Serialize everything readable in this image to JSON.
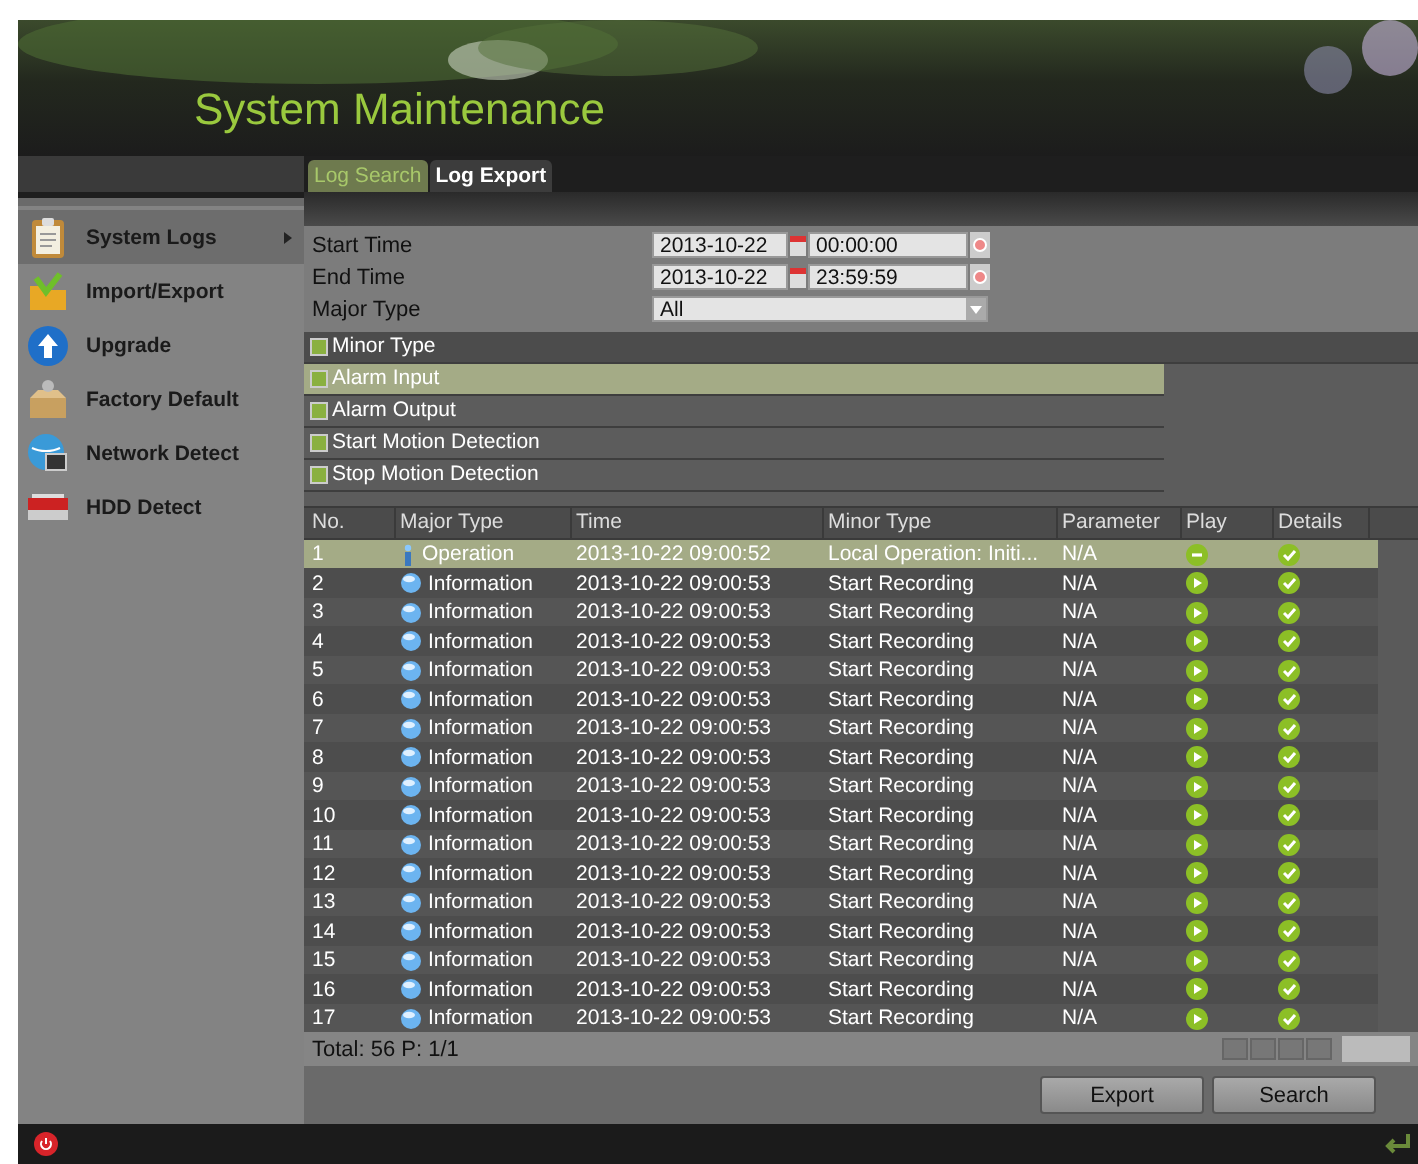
{
  "window": {
    "title": "System Maintenance"
  },
  "sidebar": {
    "items": [
      {
        "label": "System Logs",
        "kind": "logs",
        "selected": true
      },
      {
        "label": "Import/Export",
        "kind": "import",
        "selected": false
      },
      {
        "label": "Upgrade",
        "kind": "upgrade",
        "selected": false
      },
      {
        "label": "Factory Default",
        "kind": "factory",
        "selected": false
      },
      {
        "label": "Network Detect",
        "kind": "network",
        "selected": false
      },
      {
        "label": "HDD Detect",
        "kind": "hdd",
        "selected": false
      }
    ]
  },
  "tabs": [
    {
      "label": "Log Search",
      "selected": true
    },
    {
      "label": "Log Export",
      "selected": false
    }
  ],
  "form": {
    "start_time": {
      "label": "Start Time",
      "date": "2013-10-22",
      "time": "00:00:00"
    },
    "end_time": {
      "label": "End Time",
      "date": "2013-10-22",
      "time": "23:59:59"
    },
    "major_type": {
      "label": "Major Type",
      "value": "All"
    }
  },
  "minor_type_header": {
    "label": "Minor Type",
    "checked": true
  },
  "minor_types": [
    {
      "label": "Alarm Input",
      "checked": true,
      "selected": true
    },
    {
      "label": "Alarm Output",
      "checked": true,
      "selected": false
    },
    {
      "label": "Start Motion Detection",
      "checked": true,
      "selected": false
    },
    {
      "label": "Stop Motion Detection",
      "checked": true,
      "selected": false
    }
  ],
  "table": {
    "columns": [
      "No.",
      "Major Type",
      "Time",
      "Minor Type",
      "Parameter",
      "Play",
      "Details"
    ],
    "rows": [
      {
        "no": "1",
        "major_type": "Operation",
        "kind": "operation",
        "time": "2013-10-22 09:00:52",
        "minor_type": "Local Operation: Initi...",
        "parameter": "N/A",
        "playable": false,
        "selected": true
      },
      {
        "no": "2",
        "major_type": "Information",
        "kind": "information",
        "time": "2013-10-22 09:00:53",
        "minor_type": "Start Recording",
        "parameter": "N/A",
        "playable": true,
        "selected": false
      },
      {
        "no": "3",
        "major_type": "Information",
        "kind": "information",
        "time": "2013-10-22 09:00:53",
        "minor_type": "Start Recording",
        "parameter": "N/A",
        "playable": true,
        "selected": false
      },
      {
        "no": "4",
        "major_type": "Information",
        "kind": "information",
        "time": "2013-10-22 09:00:53",
        "minor_type": "Start Recording",
        "parameter": "N/A",
        "playable": true,
        "selected": false
      },
      {
        "no": "5",
        "major_type": "Information",
        "kind": "information",
        "time": "2013-10-22 09:00:53",
        "minor_type": "Start Recording",
        "parameter": "N/A",
        "playable": true,
        "selected": false
      },
      {
        "no": "6",
        "major_type": "Information",
        "kind": "information",
        "time": "2013-10-22 09:00:53",
        "minor_type": "Start Recording",
        "parameter": "N/A",
        "playable": true,
        "selected": false
      },
      {
        "no": "7",
        "major_type": "Information",
        "kind": "information",
        "time": "2013-10-22 09:00:53",
        "minor_type": "Start Recording",
        "parameter": "N/A",
        "playable": true,
        "selected": false
      },
      {
        "no": "8",
        "major_type": "Information",
        "kind": "information",
        "time": "2013-10-22 09:00:53",
        "minor_type": "Start Recording",
        "parameter": "N/A",
        "playable": true,
        "selected": false
      },
      {
        "no": "9",
        "major_type": "Information",
        "kind": "information",
        "time": "2013-10-22 09:00:53",
        "minor_type": "Start Recording",
        "parameter": "N/A",
        "playable": true,
        "selected": false
      },
      {
        "no": "10",
        "major_type": "Information",
        "kind": "information",
        "time": "2013-10-22 09:00:53",
        "minor_type": "Start Recording",
        "parameter": "N/A",
        "playable": true,
        "selected": false
      },
      {
        "no": "11",
        "major_type": "Information",
        "kind": "information",
        "time": "2013-10-22 09:00:53",
        "minor_type": "Start Recording",
        "parameter": "N/A",
        "playable": true,
        "selected": false
      },
      {
        "no": "12",
        "major_type": "Information",
        "kind": "information",
        "time": "2013-10-22 09:00:53",
        "minor_type": "Start Recording",
        "parameter": "N/A",
        "playable": true,
        "selected": false
      },
      {
        "no": "13",
        "major_type": "Information",
        "kind": "information",
        "time": "2013-10-22 09:00:53",
        "minor_type": "Start Recording",
        "parameter": "N/A",
        "playable": true,
        "selected": false
      },
      {
        "no": "14",
        "major_type": "Information",
        "kind": "information",
        "time": "2013-10-22 09:00:53",
        "minor_type": "Start Recording",
        "parameter": "N/A",
        "playable": true,
        "selected": false
      },
      {
        "no": "15",
        "major_type": "Information",
        "kind": "information",
        "time": "2013-10-22 09:00:53",
        "minor_type": "Start Recording",
        "parameter": "N/A",
        "playable": true,
        "selected": false
      },
      {
        "no": "16",
        "major_type": "Information",
        "kind": "information",
        "time": "2013-10-22 09:00:53",
        "minor_type": "Start Recording",
        "parameter": "N/A",
        "playable": true,
        "selected": false
      },
      {
        "no": "17",
        "major_type": "Information",
        "kind": "information",
        "time": "2013-10-22 09:00:53",
        "minor_type": "Start Recording",
        "parameter": "N/A",
        "playable": true,
        "selected": false
      }
    ]
  },
  "status": {
    "total": "Total: 56  P: 1/1"
  },
  "buttons": [
    "Export",
    "Search"
  ]
}
